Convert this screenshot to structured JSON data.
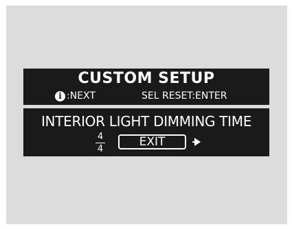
{
  "screen": {
    "title": "CUSTOM SETUP",
    "hints": {
      "info_icon_glyph": "i",
      "next_label": ":NEXT",
      "reset_label": "SEL RESET:ENTER"
    },
    "setting": {
      "name": "INTERIOR LIGHT DIMMING TIME",
      "position_numerator": "4",
      "position_denominator": "4",
      "option_label": "EXIT"
    }
  },
  "colors": {
    "background": "#dcdcdc",
    "panel": "#1a1a1a",
    "text": "#ffffff"
  },
  "icons": {
    "info": "info-icon",
    "arrow": "right-arrow-icon"
  }
}
